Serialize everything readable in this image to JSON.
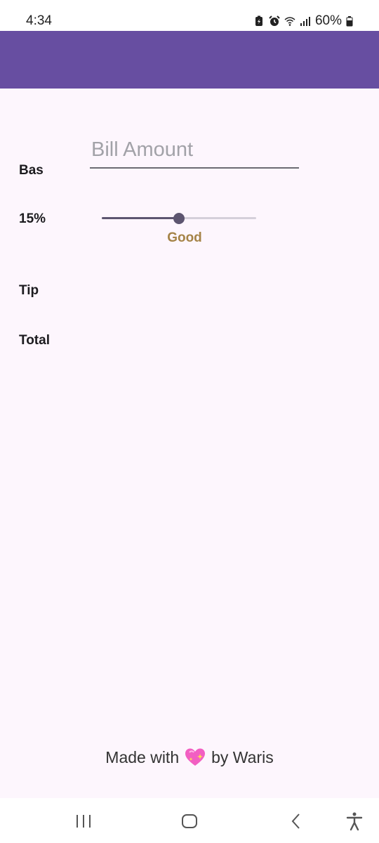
{
  "status_bar": {
    "time": "4:34",
    "battery_percent": "60%",
    "icons": [
      "battery-saver-icon",
      "alarm-icon",
      "wifi-icon",
      "signal-icon",
      "battery-icon"
    ]
  },
  "app_bar": {
    "color": "#674ea1"
  },
  "form": {
    "base_label": "Bas",
    "bill_placeholder": "Bill Amount",
    "bill_value": "",
    "tip_percent_label": "15%",
    "tip_slider_value_percent": 50,
    "tip_description": "Good",
    "tip_label": "Tip",
    "total_label": "Total"
  },
  "footer": {
    "made_with": "Made with",
    "by": "by Waris",
    "icon": "sparkling-heart-icon"
  },
  "nav_bar": {
    "icons": [
      "recent-apps-icon",
      "home-icon",
      "back-icon",
      "accessibility-icon"
    ]
  }
}
